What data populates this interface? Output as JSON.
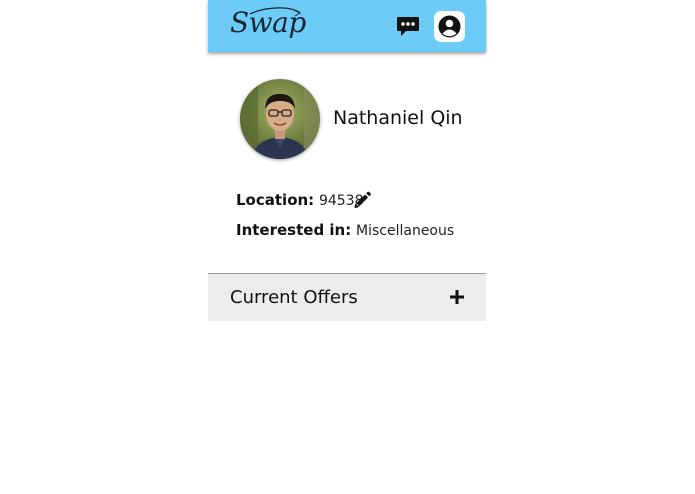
{
  "header": {
    "logo_text": "Swap",
    "chat_icon": "chat-bubble-icon",
    "profile_icon": "user-circle-icon",
    "background_color": "#6cccf7"
  },
  "profile": {
    "name": "Nathaniel Qin",
    "location_label": "Location:",
    "location_value": "94538",
    "interest_label": "Interested in:",
    "interest_value": "Miscellaneous",
    "edit_icon": "pencil-icon"
  },
  "offers": {
    "title": "Current Offers",
    "add_icon": "plus-icon"
  }
}
